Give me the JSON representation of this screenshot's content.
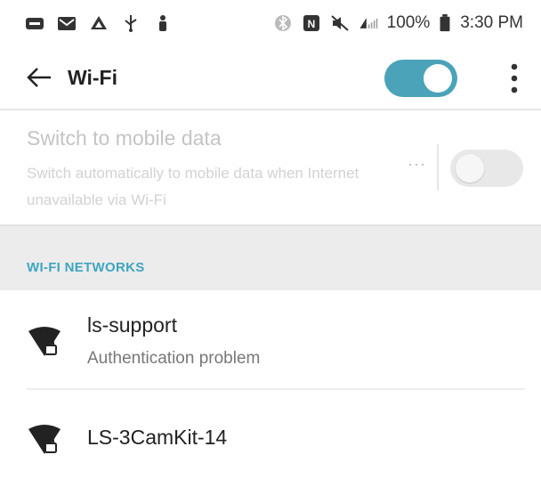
{
  "status_bar": {
    "left_icons": [
      "message-icon",
      "gmail-icon",
      "drive-icon",
      "usb-icon",
      "person-icon"
    ],
    "right_icons": [
      "bluetooth-icon",
      "nfc-icon",
      "mute-icon",
      "signal-icon"
    ],
    "battery": "100%",
    "time": "3:30 PM"
  },
  "app_bar": {
    "title": "Wi-Fi",
    "wifi_enabled": true
  },
  "mobile_data": {
    "title": "Switch to mobile data",
    "subtitle": "Switch automatically to mobile data when Internet unavailable via Wi-Fi",
    "more": "···",
    "enabled": false
  },
  "section": {
    "label": "WI-FI NETWORKS"
  },
  "networks": [
    {
      "name": "ls-support",
      "status": "Authentication problem",
      "icon": "wifi-lock-icon"
    },
    {
      "name": "LS-3CamKit-14",
      "status": "",
      "icon": "wifi-lock-icon"
    }
  ],
  "colors": {
    "accent": "#4aa3b9",
    "section_label": "#3fa5c0"
  }
}
